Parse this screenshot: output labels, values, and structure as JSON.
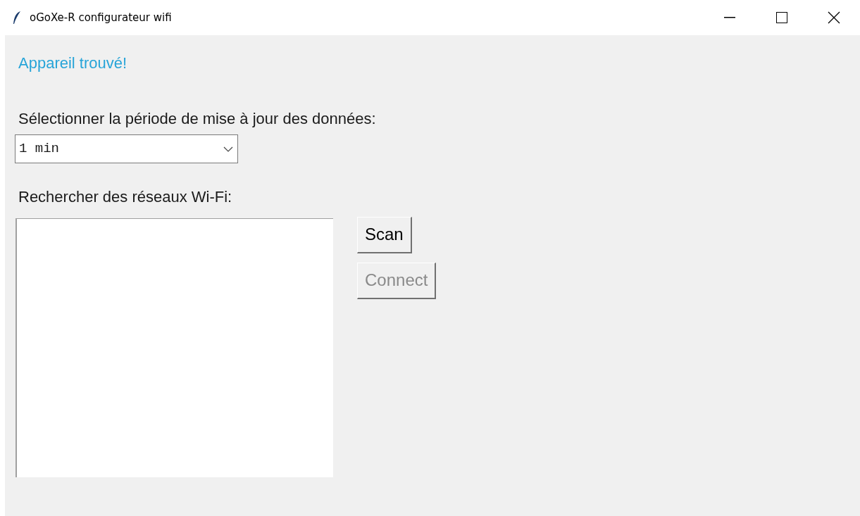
{
  "window": {
    "title": "oGoXe-R configurateur wifi"
  },
  "status": {
    "text": "Appareil trouvé!"
  },
  "period": {
    "label": "Sélectionner la période de mise à jour des données:",
    "value": "1 min"
  },
  "networks": {
    "label": "Rechercher des réseaux Wi-Fi:"
  },
  "buttons": [
    {
      "label": "Scan",
      "disabled": false
    },
    {
      "label": "Connect",
      "disabled": true
    }
  ]
}
